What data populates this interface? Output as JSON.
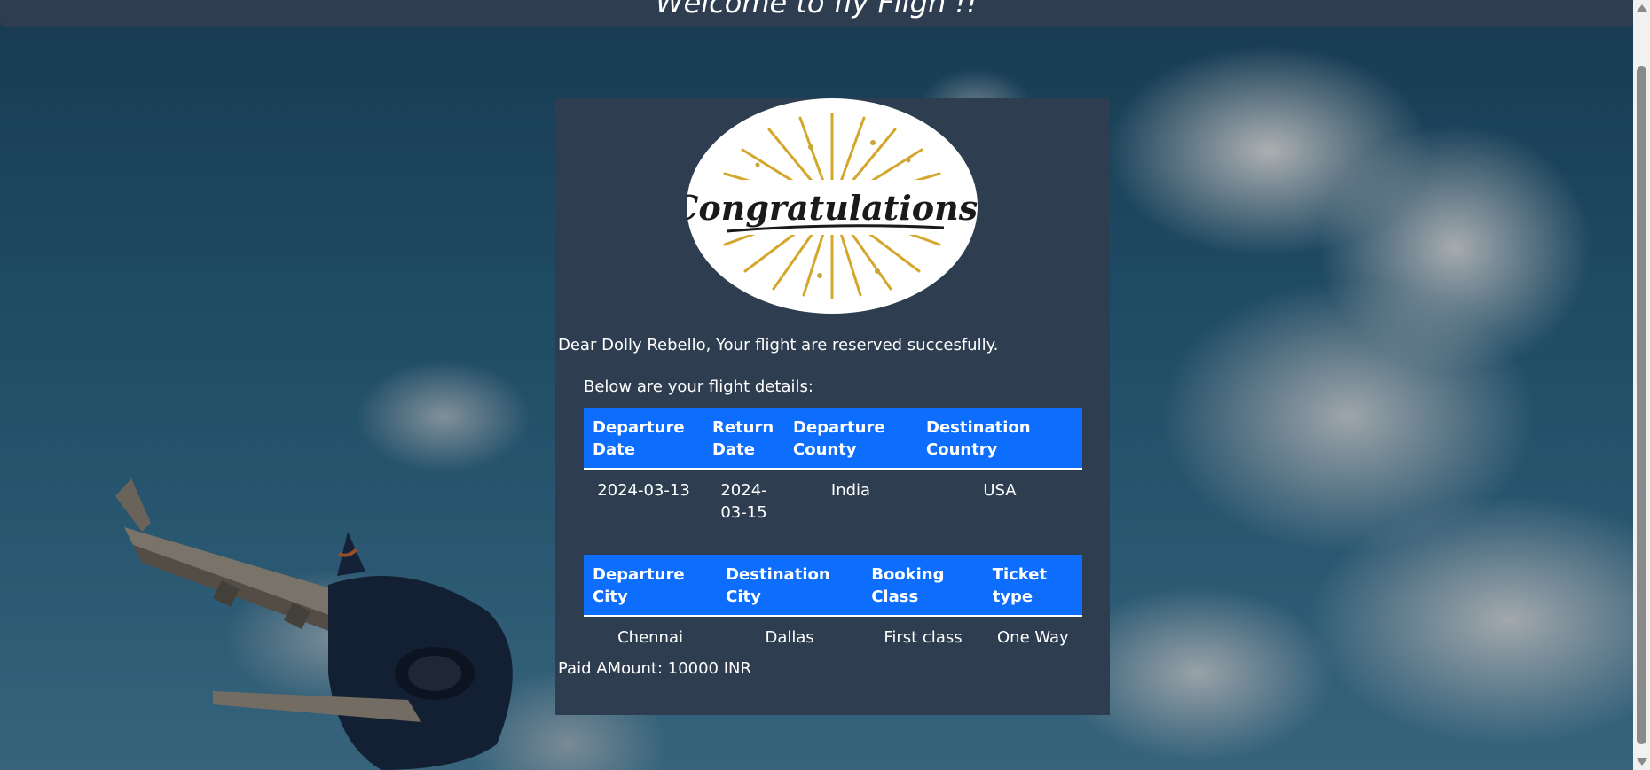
{
  "header": {
    "title": "Welcome to fly Fligh !!"
  },
  "greeting": "Dear Dolly Rebello, Your flight are reserved succesfully.",
  "details_heading": "Below are your flight details:",
  "table1": {
    "headers": [
      "Departure Date",
      "Return Date",
      "Departure County",
      "Destination Country"
    ],
    "row": [
      "2024-03-13",
      "2024-03-15",
      "India",
      "USA"
    ]
  },
  "table2": {
    "headers": [
      "Departure City",
      "Destination City",
      "Booking Class",
      "Ticket type"
    ],
    "row": [
      "Chennai",
      "Dallas",
      "First class",
      "One Way"
    ]
  },
  "paid_amount": "Paid AMount: 10000 INR",
  "badge": {
    "text": "Congratulations!"
  },
  "colors": {
    "header_bg": "#2e3e50",
    "card_bg": "#2e3e50",
    "table_header_bg": "#0d6efd",
    "badge_gold": "#d4a72c"
  }
}
